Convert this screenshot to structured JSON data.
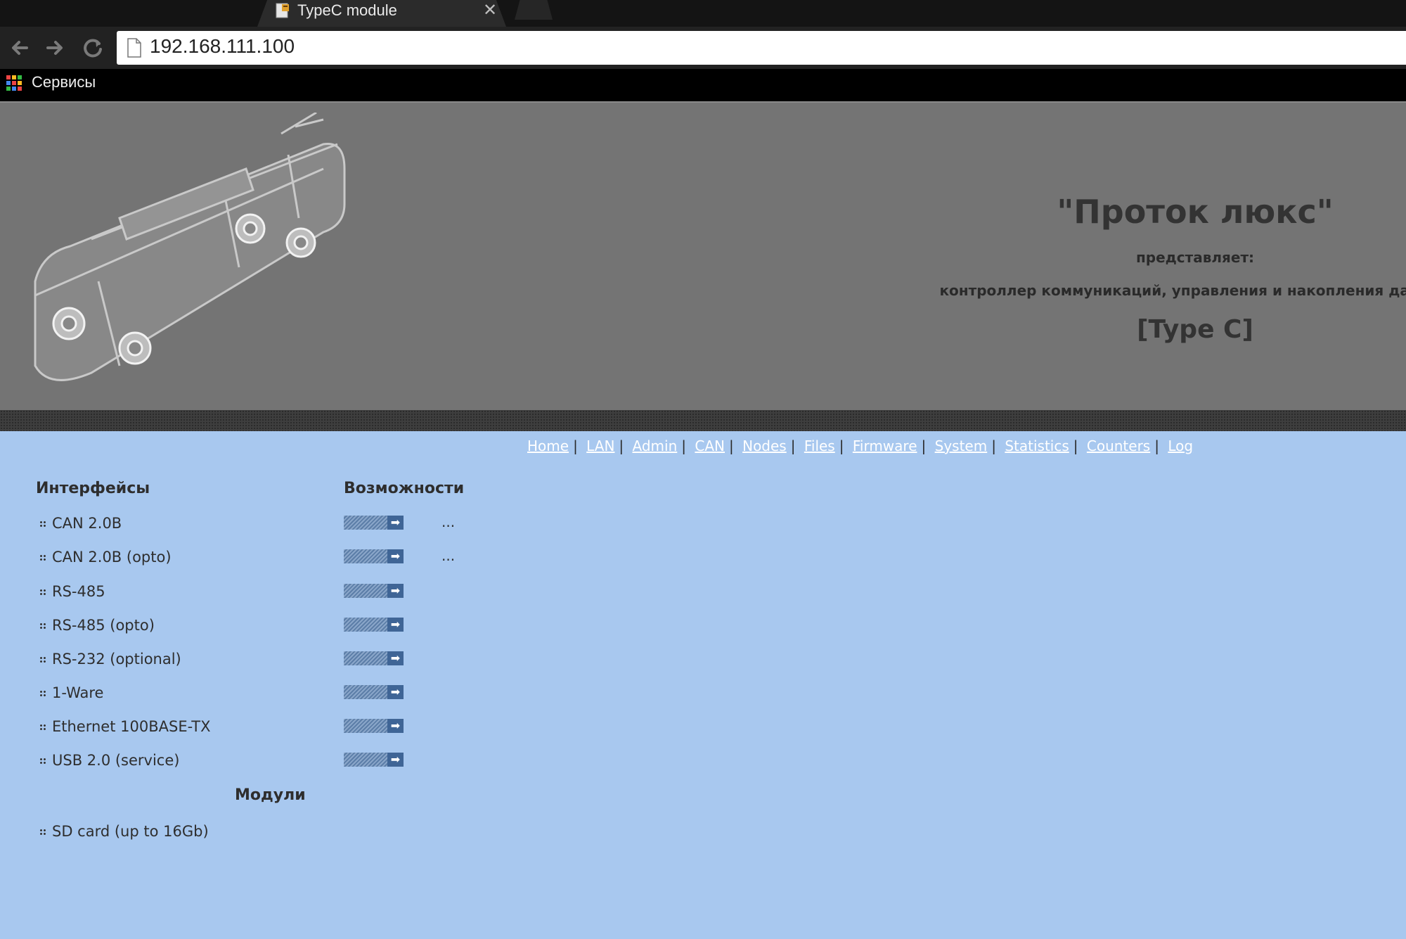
{
  "browser": {
    "tab_title": "TypeC module",
    "tab_close": "✕",
    "url": "192.168.111.100",
    "bookmark_label": "Сервисы"
  },
  "header": {
    "title": "\"Проток люкс\"",
    "presents": "представляет:",
    "description": "контроллер коммуникаций, управления и накопления данных",
    "model": "[Type C]"
  },
  "nav": {
    "links": [
      "Home",
      "LAN",
      "Admin",
      "CAN",
      "Nodes",
      "Files",
      "Firmware",
      "System",
      "Statistics",
      "Counters",
      "Log"
    ],
    "separator": "|"
  },
  "content": {
    "interfaces_heading": "Интерфейсы",
    "features_heading": "Возможности",
    "interfaces": [
      {
        "label": "CAN 2.0B",
        "more": "..."
      },
      {
        "label": "CAN 2.0B (opto)",
        "more": "..."
      },
      {
        "label": "RS-485",
        "more": ""
      },
      {
        "label": "RS-485 (opto)",
        "more": ""
      },
      {
        "label": "RS-232 (optional)",
        "more": ""
      },
      {
        "label": "1-Ware",
        "more": ""
      },
      {
        "label": "Ethernet 100BASE-TX",
        "more": ""
      },
      {
        "label": "USB 2.0 (service)",
        "more": ""
      }
    ],
    "modules_heading": "Модули",
    "modules": [
      {
        "label": "SD card (up to 16Gb)"
      }
    ],
    "go_arrow": "➡"
  },
  "colors": {
    "page_bg": "#a8c8ef",
    "hero_bg": "#747474",
    "button_accent": "#3f6596"
  }
}
